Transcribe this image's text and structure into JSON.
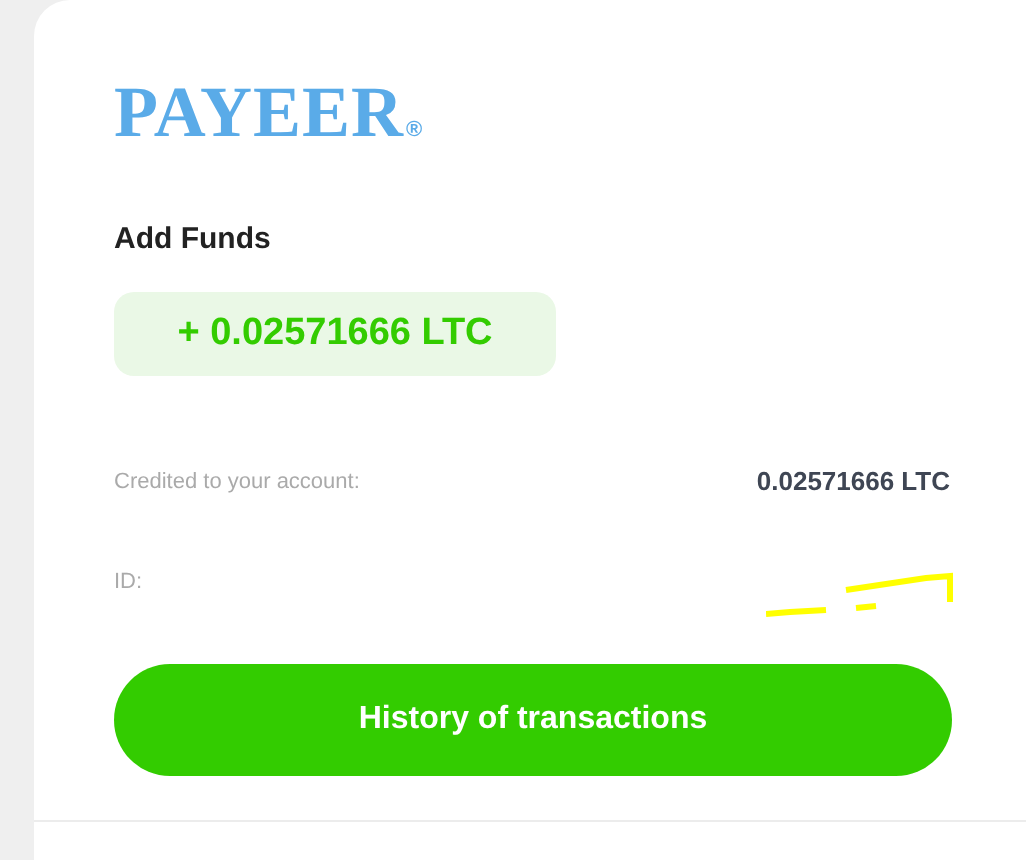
{
  "logo": {
    "text": "PAYEER",
    "mark": "®"
  },
  "heading": "Add Funds",
  "amount_badge": "+ 0.02571666 LTC",
  "details": [
    {
      "label": "Credited to your account:",
      "value": "0.02571666 LTC"
    },
    {
      "label": "ID:"
    }
  ],
  "button": "History of transactions"
}
